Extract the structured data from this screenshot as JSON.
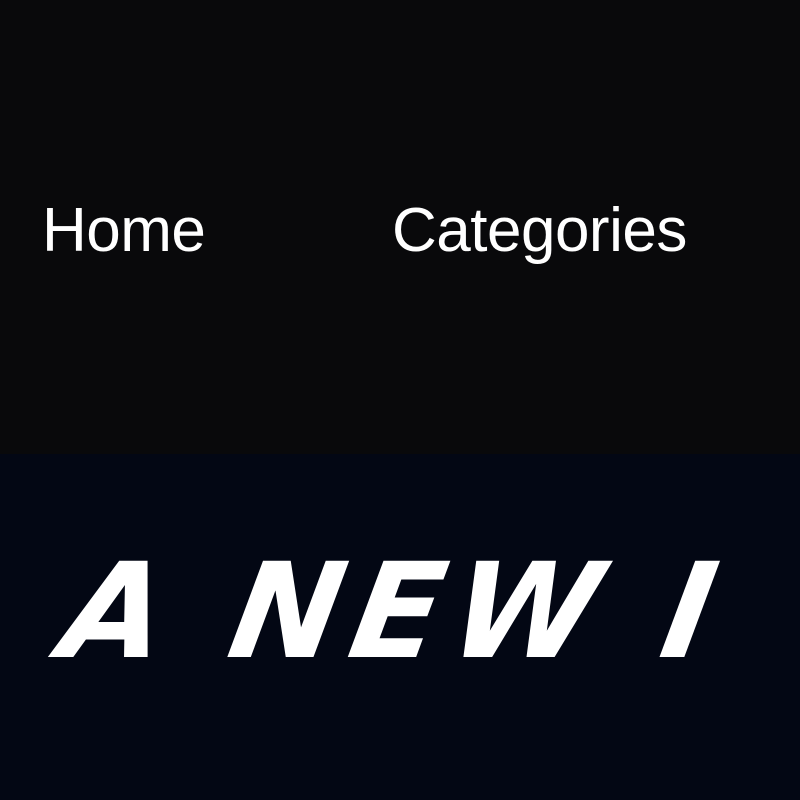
{
  "nav": {
    "links": [
      {
        "label": "Home"
      },
      {
        "label": "Categories"
      }
    ]
  },
  "hero": {
    "title": "A NEW I"
  },
  "colors": {
    "nav_background": "#09090b",
    "hero_background": "#030714",
    "text": "#ffffff"
  }
}
